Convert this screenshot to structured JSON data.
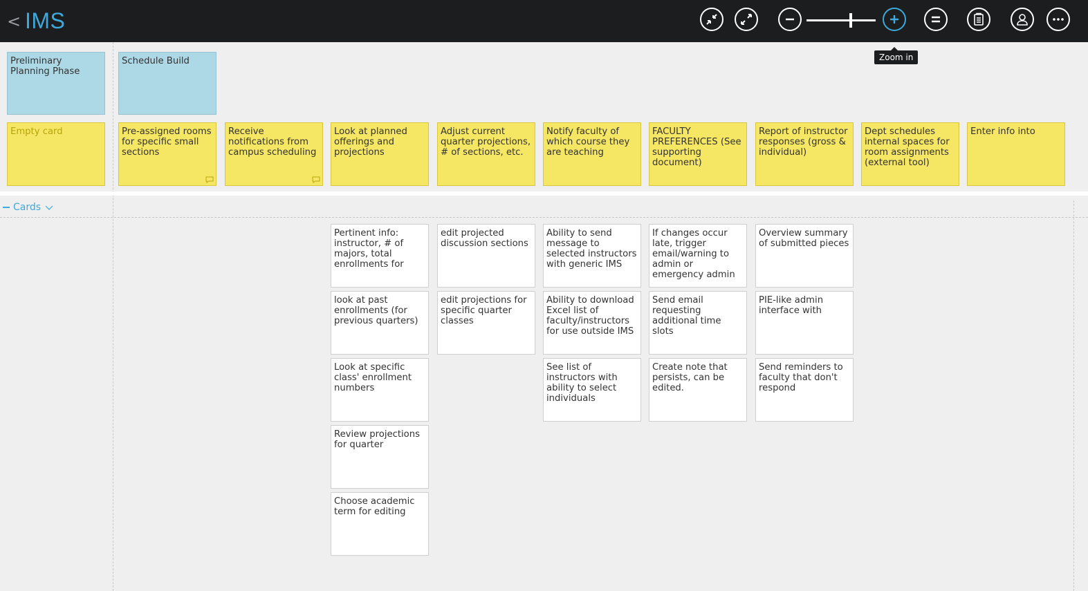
{
  "header": {
    "back_glyph": "<",
    "title": "IMS",
    "accent": "#3ea9dd",
    "tooltip": "Zoom in",
    "buttons": [
      {
        "name": "collapse-icon"
      },
      {
        "name": "expand-icon"
      },
      {
        "name": "zoom-out-icon"
      },
      {
        "name": "zoom-in-icon"
      },
      {
        "name": "menu-equal-icon"
      },
      {
        "name": "clipboard-icon"
      },
      {
        "name": "user-icon"
      },
      {
        "name": "more-icon"
      }
    ]
  },
  "activities": [
    {
      "label": "Preliminary Planning Phase"
    },
    {
      "label": "Schedule Build"
    }
  ],
  "tasks": [
    {
      "label": "Empty card",
      "empty": true
    },
    {
      "label": "Pre-assigned rooms for specific small sections",
      "comment": true
    },
    {
      "label": "Receive notifications from campus scheduling",
      "comment": true
    },
    {
      "label": "Look at planned offerings and projections"
    },
    {
      "label": "Adjust current quarter projections, # of sections, etc."
    },
    {
      "label": "Notify faculty of which course they are teaching"
    },
    {
      "label": "FACULTY PREFERENCES (See supporting document)"
    },
    {
      "label": "Report of instructor responses (gross & individual)"
    },
    {
      "label": "Dept schedules internal spaces for room assignments (external tool)"
    },
    {
      "label": "Enter info into"
    }
  ],
  "lane": {
    "label": "Cards"
  },
  "cards": {
    "col4": [
      "Pertinent info: instructor, # of majors, total enrollments for",
      "look at past enrollments (for previous quarters)",
      "Look at specific class' enrollment numbers",
      "Review projections for quarter",
      "Choose academic term for editing"
    ],
    "col5": [
      "edit projected discussion sections",
      "edit projections for specific quarter classes"
    ],
    "col6": [
      "Ability to send message to selected instructors with generic IMS",
      "Ability to download Excel list of faculty/instructors for use outside IMS",
      "See list of instructors with ability to select individuals"
    ],
    "col7": [
      "If changes occur late, trigger email/warning to admin or emergency admin",
      "Send email requesting additional time slots",
      "Create note that persists, can be edited."
    ],
    "col8": [
      "Overview summary of submitted pieces",
      "PIE-like admin interface with",
      "Send reminders to faculty that don't respond"
    ]
  }
}
